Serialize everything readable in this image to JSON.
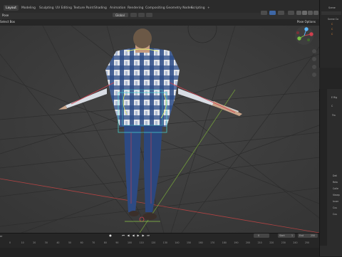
{
  "workspaces": [
    "Layout",
    "Modeling",
    "Sculpting",
    "UV Editing",
    "Texture Paint",
    "Shading",
    "Animation",
    "Rendering",
    "Compositing",
    "Geometry Nodes",
    "Scripting"
  ],
  "add_tab_glyph": "+",
  "header": {
    "mode": "Pose",
    "select_box": "Select Box",
    "transform_orientation": "Global",
    "pose_options": "Pose Options"
  },
  "outliner": {
    "title": "Scene",
    "first_item": "Scene Co",
    "rows": [
      "C",
      "C",
      "C"
    ]
  },
  "properties": {
    "tab_label_1": "E Rig",
    "tab_label_2": "C",
    "section_1": "Tra",
    "rows": [
      "Deli",
      "Rela",
      "Colle",
      "Viewp",
      "Inver",
      "Cus",
      "Cus"
    ]
  },
  "timeline": {
    "ruler": [
      "0",
      "10",
      "20",
      "30",
      "40",
      "50",
      "60",
      "70",
      "80",
      "90",
      "100",
      "110",
      "120",
      "130",
      "140",
      "150",
      "160",
      "170",
      "180",
      "190",
      "200",
      "210",
      "220",
      "230",
      "240",
      "250"
    ],
    "current_frame": "0",
    "start_label": "Start",
    "start_value": "1",
    "end_label": "End",
    "end_value": "250",
    "marker_label": "er"
  },
  "colors": {
    "viewport_bg": "#3d3d3d",
    "grid_red": "#b04343",
    "grid_green": "#6f9a3a",
    "bone_select": "#e3f06c",
    "bone_cyan": "#4ad8d8",
    "bone_red": "#d0404e",
    "shirt_blue": "#2f4d8a",
    "jeans": "#2d4a83"
  },
  "gizmo": {
    "x_label": "X",
    "y_label": "Y",
    "z_label": "Z"
  }
}
